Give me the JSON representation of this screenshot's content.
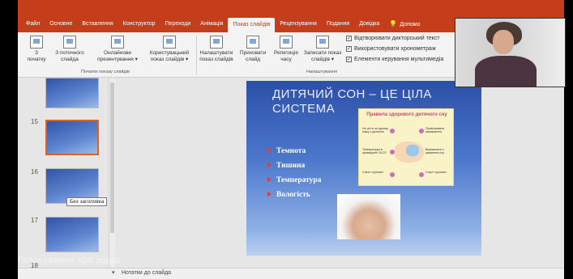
{
  "tabs": [
    "Файл",
    "Основне",
    "Вставлення",
    "Конструктор",
    "Переходи",
    "Анімація",
    "Показ слайдів",
    "Рецензування",
    "Подання",
    "Довідка",
    "Допомо"
  ],
  "active_tab_index": 6,
  "ribbon": {
    "buttons": [
      {
        "label1": "З",
        "label2": "початку"
      },
      {
        "label1": "З поточного",
        "label2": "слайда"
      },
      {
        "label1": "Онлайнове",
        "label2": "презентування ▾"
      },
      {
        "label1": "Користувацький",
        "label2": "показ слайдів ▾"
      },
      {
        "label1": "Налаштувати",
        "label2": "показ слайдів"
      },
      {
        "label1": "Приховати",
        "label2": "слайд"
      },
      {
        "label1": "Репетиція",
        "label2": "часу"
      },
      {
        "label1": "Записати показ",
        "label2": "слайдів ▾"
      }
    ],
    "groups": [
      "Початок показу слайдів",
      "Налаштування"
    ],
    "checkboxes": [
      {
        "label": "Відтворювати дикторський текст",
        "checked": "✓"
      },
      {
        "label": "Використовувати хронометраж",
        "checked": "✓"
      },
      {
        "label": "Елементи керування мультимедіа",
        "checked": "✓"
      }
    ]
  },
  "thumbnails": {
    "numbers": [
      "15",
      "16",
      "17",
      "18"
    ],
    "tooltip": "Без заголовка"
  },
  "slide": {
    "title": "ДИТЯЧИЙ СОН – ЦЕ ЦІЛА СИСТЕМА",
    "bullets": [
      "Темнота",
      "Тишина",
      "Температура",
      "Вологість"
    ],
    "poster": {
      "title": "Правила здорового дитячого сну",
      "items": [
        "Не спіть на одному ліжку з дитиною",
        "Провітрювати приміщення",
        "Температура в приміщенні 18-22°",
        "Вимикатися з увімкнени сну",
        "Спати «рульки»",
        "Спорт «рульки»"
      ]
    }
  },
  "notes_label": "Нотатки до слайда",
  "overlay_text": "Голосування про відео"
}
